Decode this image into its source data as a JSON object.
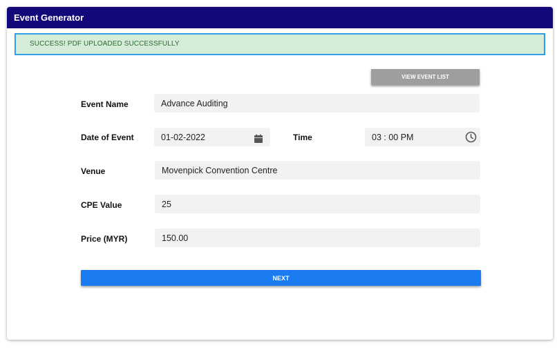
{
  "app": {
    "title": "Event Generator"
  },
  "alert": {
    "message": "SUCCESS! PDF UPLOADED SUCCESSFULLY"
  },
  "toolbar": {
    "view_event_list_label": "VIEW EVENT LIST"
  },
  "form": {
    "event_name": {
      "label": "Event Name",
      "value": "Advance Auditing"
    },
    "date_of_event": {
      "label": "Date of Event",
      "value": "01-02-2022",
      "icon": "calendar-icon"
    },
    "time": {
      "label": "Time",
      "value": "03 : 00 PM",
      "icon": "clock-icon"
    },
    "venue": {
      "label": "Venue",
      "value": "Movenpick Convention Centre"
    },
    "cpe_value": {
      "label": "CPE Value",
      "value": "25"
    },
    "price": {
      "label": "Price (MYR)",
      "value": "150.00"
    }
  },
  "actions": {
    "next_label": "NEXT"
  },
  "colors": {
    "titlebar": "#13087a",
    "alert_bg": "#d5ecd8",
    "alert_border": "#2e9ee8",
    "alert_text": "#2c6b30",
    "primary": "#1a7cf0",
    "secondary": "#9e9e9e"
  }
}
